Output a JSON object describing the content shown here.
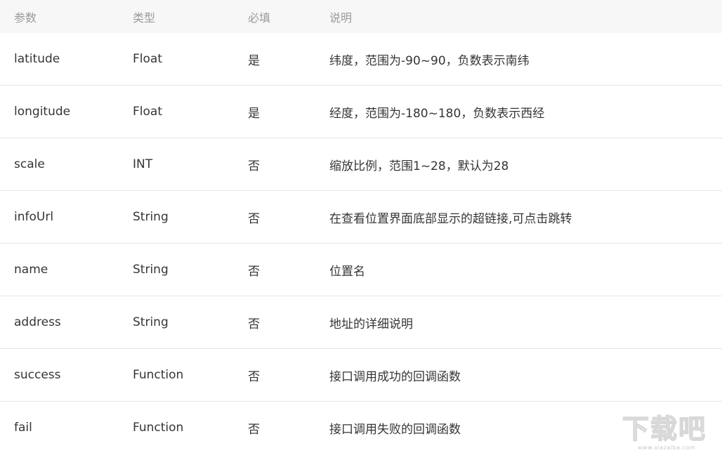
{
  "table": {
    "headers": [
      "参数",
      "类型",
      "必填",
      "说明"
    ],
    "rows": [
      {
        "param": "latitude",
        "type": "Float",
        "required": "是",
        "desc": "纬度，范围为-90~90，负数表示南纬"
      },
      {
        "param": "longitude",
        "type": "Float",
        "required": "是",
        "desc": "经度，范围为-180~180，负数表示西经"
      },
      {
        "param": "scale",
        "type": "INT",
        "required": "否",
        "desc": "缩放比例，范围1~28，默认为28"
      },
      {
        "param": "infoUrl",
        "type": "String",
        "required": "否",
        "desc": "在查看位置界面底部显示的超链接,可点击跳转"
      },
      {
        "param": "name",
        "type": "String",
        "required": "否",
        "desc": "位置名"
      },
      {
        "param": "address",
        "type": "String",
        "required": "否",
        "desc": "地址的详细说明"
      },
      {
        "param": "success",
        "type": "Function",
        "required": "否",
        "desc": "接口调用成功的回调函数"
      },
      {
        "param": "fail",
        "type": "Function",
        "required": "否",
        "desc": "接口调用失败的回调函数"
      }
    ]
  },
  "watermark": {
    "logo_text": "下载吧",
    "url_text": "www.xiazaiba.com"
  }
}
